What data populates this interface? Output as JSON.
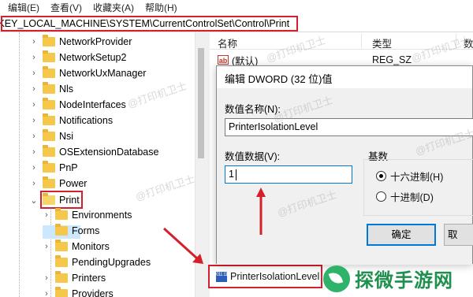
{
  "menu": {
    "items": [
      "编辑(E)",
      "查看(V)",
      "收藏夹(A)",
      "帮助(H)"
    ]
  },
  "address": {
    "path": "\\KEY_LOCAL_MACHINE\\SYSTEM\\CurrentControlSet\\Control\\Print"
  },
  "tree": {
    "items": [
      {
        "label": "NetworkProvider",
        "expanded": false
      },
      {
        "label": "NetworkSetup2",
        "expanded": false
      },
      {
        "label": "NetworkUxManager",
        "expanded": false
      },
      {
        "label": "Nls",
        "expanded": false
      },
      {
        "label": "NodeInterfaces",
        "expanded": false
      },
      {
        "label": "Notifications",
        "expanded": false
      },
      {
        "label": "Nsi",
        "expanded": false
      },
      {
        "label": "OSExtensionDatabase",
        "expanded": false
      },
      {
        "label": "PnP",
        "expanded": false
      },
      {
        "label": "Power",
        "expanded": false
      },
      {
        "label": "Print",
        "expanded": true,
        "selected": true
      }
    ],
    "children": [
      {
        "label": "Environments"
      },
      {
        "label": "Forms"
      },
      {
        "label": "Monitors"
      },
      {
        "label": "PendingUpgrades"
      },
      {
        "label": "Printers"
      },
      {
        "label": "Providers"
      }
    ]
  },
  "list": {
    "headers": {
      "name": "名称",
      "type": "类型",
      "data": "数"
    },
    "rows": [
      {
        "icon": "string-value-icon",
        "icon_text": "ab",
        "name": "(默认)",
        "type": "REG_SZ"
      }
    ],
    "highlighted_row": {
      "icon": "dword-value-icon",
      "icon_text": "011 110",
      "name": "PrinterIsolationLevel"
    }
  },
  "dialog": {
    "title": "编辑 DWORD (32 位)值",
    "value_name_label": "数值名称(N):",
    "value_name": "PrinterIsolationLevel",
    "value_data_label": "数值数据(V):",
    "value_data": "1",
    "base_label": "基数",
    "radio_hex": "十六进制(H)",
    "radio_dec": "十进制(D)",
    "radio_selected": "hex",
    "ok_label": "确定",
    "cancel_label": "取"
  },
  "watermark": {
    "text": "@打印机卫士"
  },
  "logo": {
    "text": "探微手游网",
    "color": "#1f8f4e"
  },
  "colors": {
    "highlight_box": "#d4202a",
    "selection": "#cce8ff",
    "focus": "#0078d7"
  }
}
